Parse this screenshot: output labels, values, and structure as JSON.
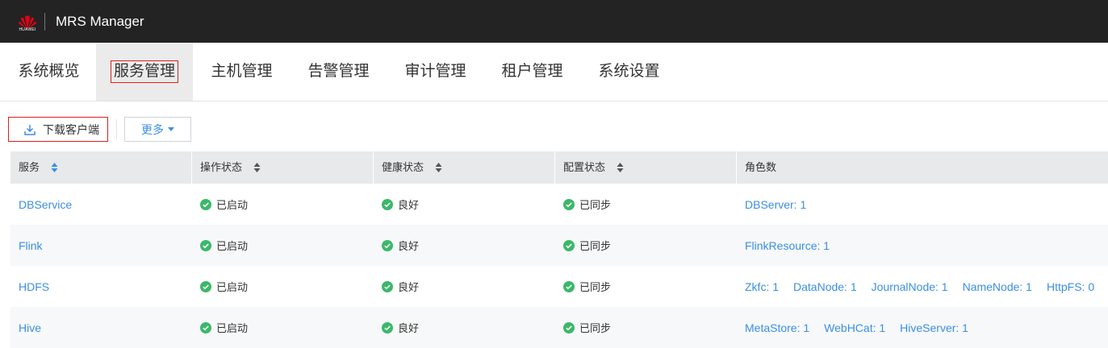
{
  "header": {
    "logo_text": "HUAWEI",
    "app_title": "MRS Manager"
  },
  "nav": {
    "items": [
      "系统概览",
      "服务管理",
      "主机管理",
      "告警管理",
      "审计管理",
      "租户管理",
      "系统设置"
    ],
    "active": "服务管理"
  },
  "toolbar": {
    "download_label": "下载客户端",
    "more_label": "更多"
  },
  "table": {
    "columns": [
      "服务",
      "操作状态",
      "健康状态",
      "配置状态",
      "角色数"
    ],
    "rows": [
      {
        "service": "DBService",
        "op_status": "已启动",
        "health": "良好",
        "config": "已同步",
        "roles": [
          "DBServer: 1"
        ]
      },
      {
        "service": "Flink",
        "op_status": "已启动",
        "health": "良好",
        "config": "已同步",
        "roles": [
          "FlinkResource: 1"
        ]
      },
      {
        "service": "HDFS",
        "op_status": "已启动",
        "health": "良好",
        "config": "已同步",
        "roles": [
          "Zkfc: 1",
          "DataNode: 1",
          "JournalNode: 1",
          "NameNode: 1",
          "HttpFS: 0"
        ]
      },
      {
        "service": "Hive",
        "op_status": "已启动",
        "health": "良好",
        "config": "已同步",
        "roles": [
          "MetaStore: 1",
          "WebHCat: 1",
          "HiveServer: 1"
        ]
      }
    ]
  },
  "colors": {
    "accent": "#3a8ee6",
    "ok_green": "#3bb86a",
    "topbar": "#232323",
    "highlight_border": "#e02020"
  }
}
